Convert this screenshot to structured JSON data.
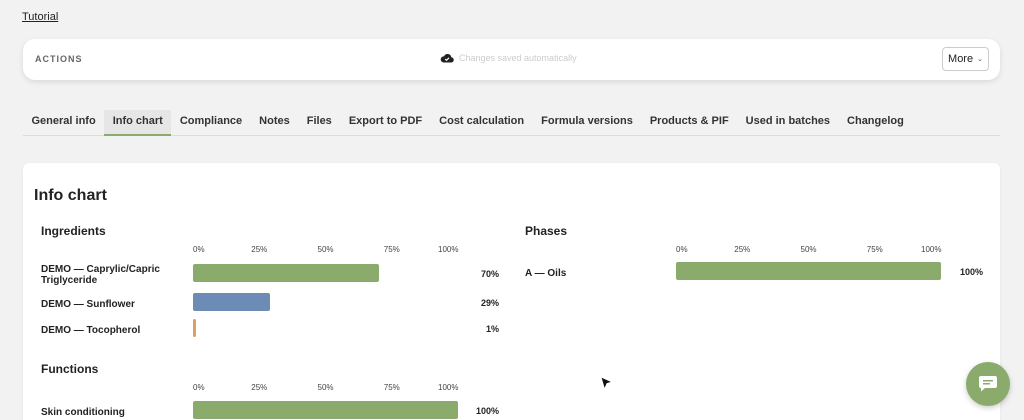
{
  "header": {
    "tutorial_link": "Tutorial"
  },
  "actions": {
    "label": "ACTIONS",
    "save_status": "Changes saved automatically",
    "more_label": "More",
    "chevron": "⌄"
  },
  "tabs": [
    {
      "label": "General info",
      "active": false
    },
    {
      "label": "Info chart",
      "active": true
    },
    {
      "label": "Compliance",
      "active": false
    },
    {
      "label": "Notes",
      "active": false
    },
    {
      "label": "Files",
      "active": false
    },
    {
      "label": "Export to PDF",
      "active": false
    },
    {
      "label": "Cost calculation",
      "active": false
    },
    {
      "label": "Formula versions",
      "active": false
    },
    {
      "label": "Products & PIF",
      "active": false
    },
    {
      "label": "Used in batches",
      "active": false
    },
    {
      "label": "Changelog",
      "active": false
    }
  ],
  "colors": {
    "accent": "#8aab6c",
    "bar_green": "#8aab6c",
    "bar_blue": "#6c8cb5",
    "bar_orange": "#d9a35f"
  },
  "card": {
    "title": "Info chart",
    "scale_ticks": [
      "0%",
      "25%",
      "50%",
      "75%",
      "100%"
    ],
    "ingredients": {
      "title": "Ingredients",
      "rows": [
        {
          "label": "DEMO — Caprylic/Capric Triglyceride",
          "value": 70,
          "display": "70%",
          "color": "#8aab6c"
        },
        {
          "label": "DEMO — Sunflower",
          "value": 29,
          "display": "29%",
          "color": "#6c8cb5"
        },
        {
          "label": "DEMO — Tocopherol",
          "value": 1,
          "display": "1%",
          "color": "#d9a35f"
        }
      ]
    },
    "phases": {
      "title": "Phases",
      "rows": [
        {
          "label": "A — Oils",
          "value": 100,
          "display": "100%",
          "color": "#8aab6c"
        }
      ]
    },
    "functions": {
      "title": "Functions",
      "rows": [
        {
          "label": "Skin conditioning",
          "value": 100,
          "display": "100%",
          "color": "#8aab6c"
        }
      ]
    }
  },
  "icons": {
    "cloud": "cloud-check-icon",
    "chat": "chat-icon",
    "cursor": "mouse-pointer-icon"
  }
}
